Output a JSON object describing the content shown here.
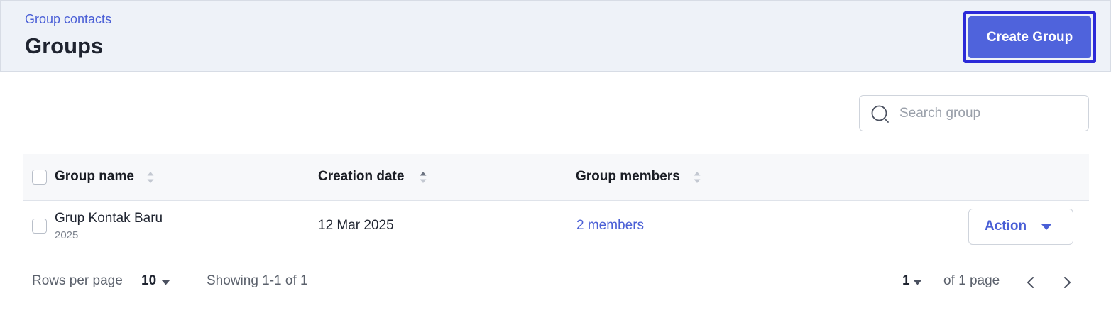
{
  "header": {
    "breadcrumb": "Group contacts",
    "title": "Groups",
    "create_button": "Create Group"
  },
  "search": {
    "placeholder": "Search group",
    "icon": "search-icon"
  },
  "table": {
    "columns": [
      {
        "label": "Group name"
      },
      {
        "label": "Creation date"
      },
      {
        "label": "Group members"
      }
    ],
    "rows": [
      {
        "name": "Grup Kontak Baru",
        "subtitle": "2025",
        "creation_date": "12 Mar 2025",
        "members": "2 members",
        "action_label": "Action"
      }
    ]
  },
  "footer": {
    "rows_per_page_label": "Rows per page",
    "rows_per_page_value": "10",
    "showing": "Showing 1-1 of 1",
    "current_page": "1",
    "page_total": "of 1 page"
  },
  "colors": {
    "accent": "#4f63dc",
    "link": "#4a5fd6",
    "highlight_border": "#2c2ad8",
    "header_bg": "#eef2f8"
  }
}
